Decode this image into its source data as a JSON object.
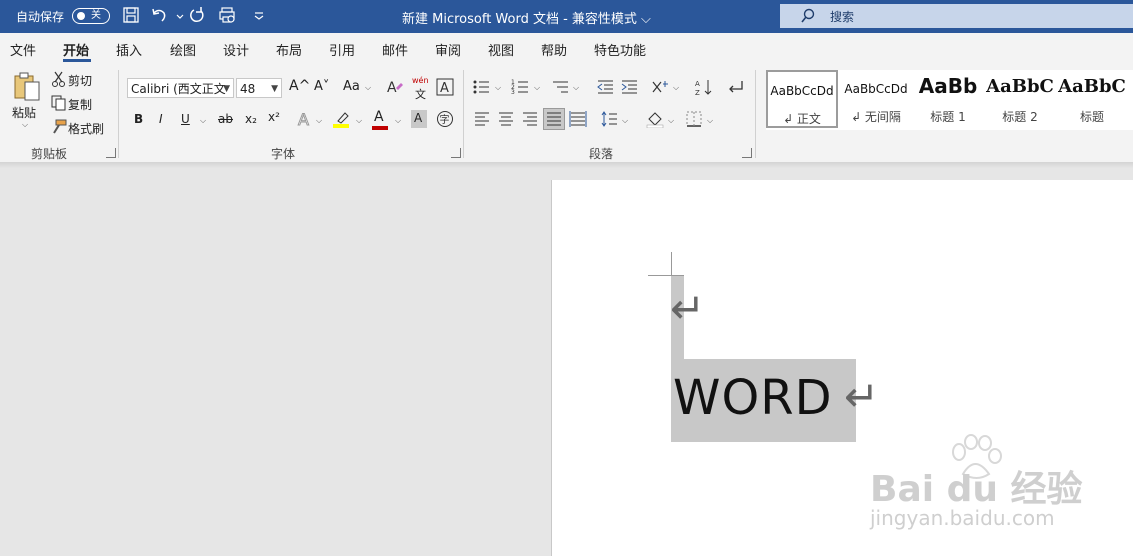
{
  "titlebar": {
    "autosave_label": "自动保存",
    "autosave_state": "关",
    "title": "新建 Microsoft Word 文档 - 兼容性模式 ⌵",
    "search_placeholder": "搜索"
  },
  "menu": {
    "tabs": [
      "文件",
      "开始",
      "插入",
      "绘图",
      "设计",
      "布局",
      "引用",
      "邮件",
      "审阅",
      "视图",
      "帮助",
      "特色功能"
    ],
    "active": "开始"
  },
  "clipboard": {
    "paste_label": "粘贴",
    "cut_label": "剪切",
    "copy_label": "复制",
    "format_painter_label": "格式刷",
    "group_label": "剪贴板"
  },
  "font": {
    "font_name": "Calibri (西文正文",
    "font_size": "48",
    "grow_label": "A^",
    "shrink_label": "A˅",
    "case_label": "Aa",
    "pinyin_label": "wén",
    "group_label": "字体",
    "bold": "B",
    "italic": "I",
    "underline": "U",
    "strike": "ab",
    "subscript": "x₂",
    "superscript": "x²",
    "font_color_label": "A",
    "shading_label": "A",
    "enclose_label": "字"
  },
  "paragraph": {
    "group_label": "段落"
  },
  "styles": {
    "items": [
      {
        "preview": "AaBbCcDd",
        "name": "↲ 正文"
      },
      {
        "preview": "AaBbCcDd",
        "name": "↲ 无间隔"
      },
      {
        "preview": "AaBb",
        "name": "标题 1"
      },
      {
        "preview": "AaBbC",
        "name": "标题 2"
      },
      {
        "preview": "AaBbC",
        "name": "标题"
      }
    ]
  },
  "document": {
    "text": "WORD",
    "para_mark": "↵"
  },
  "watermark": {
    "brand": "Bai du 经验",
    "url": "jingyan.baidu.com"
  },
  "colors": {
    "titlebar": "#2b579a",
    "highlight": "#ffff00",
    "font_color": "#c00000"
  }
}
